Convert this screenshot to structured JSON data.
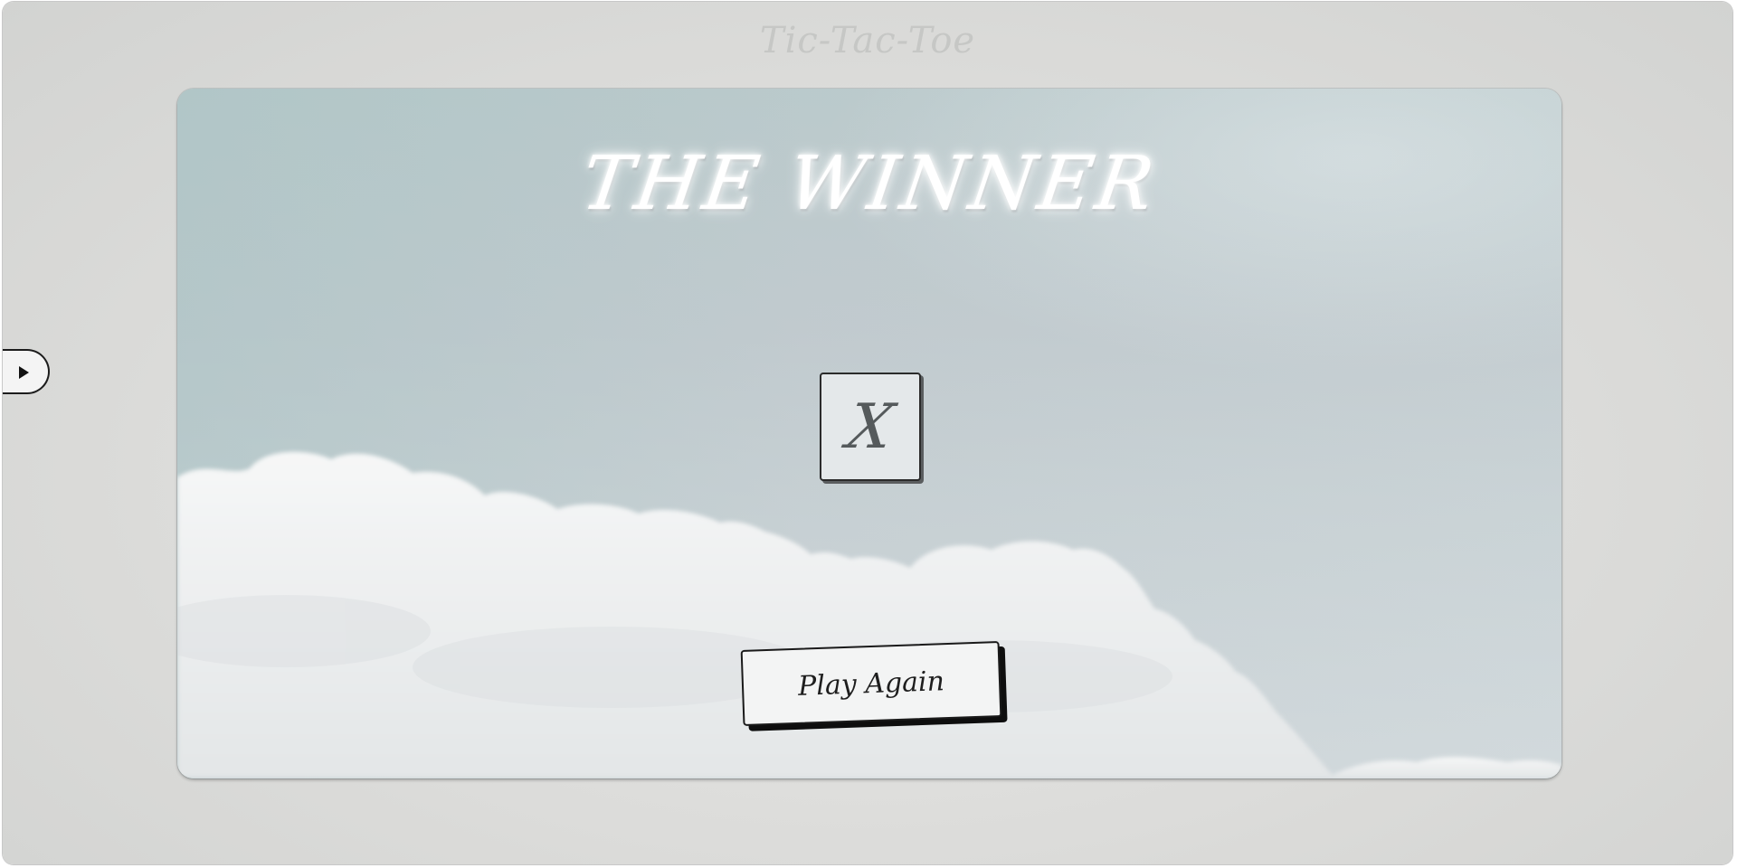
{
  "game": {
    "title": "Tic-Tac-Toe"
  },
  "result": {
    "heading": "THE WINNER",
    "winner_mark": "X"
  },
  "actions": {
    "play_again_label": "Play Again"
  },
  "sidebar": {
    "toggle_icon": "play-icon"
  },
  "colors": {
    "page_background": "#dcdcda",
    "sky": "#c2cbcf",
    "cloud": "#f0f1f1",
    "button_background": "#f3f4f4",
    "button_shadow": "#0e0e0e",
    "cell_background": "#e4e8ea",
    "heading": "#ffffff"
  }
}
